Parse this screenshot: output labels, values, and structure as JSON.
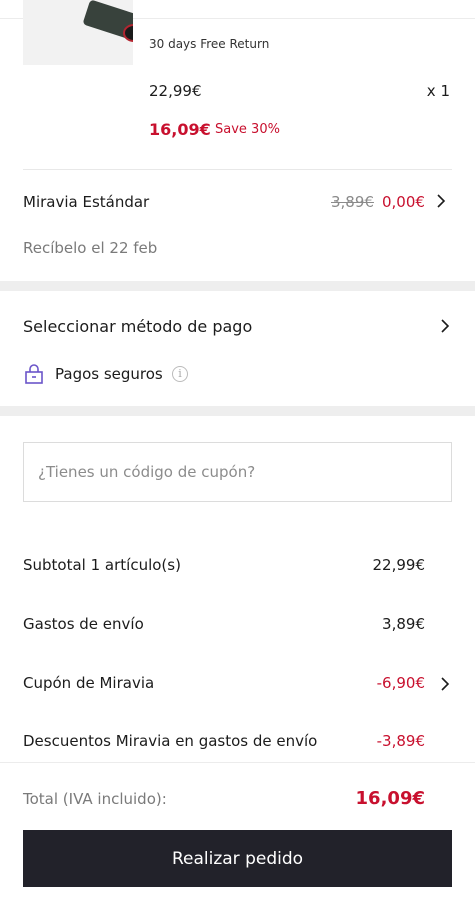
{
  "product": {
    "return_policy": "30 days Free Return",
    "price": "22,99€",
    "quantity": "x 1",
    "sale_price": "16,09€",
    "save_text": "Save 30%"
  },
  "shipping": {
    "method": "Miravia Estándar",
    "old_price": "3,89€",
    "new_price": "0,00€",
    "delivery_date": "Recíbelo el 22 feb"
  },
  "payment": {
    "select_label": "Seleccionar método de pago",
    "secure_label": "Pagos seguros",
    "info_glyph": "i"
  },
  "coupon": {
    "placeholder": "¿Tienes un código de cupón?",
    "value": ""
  },
  "summary": {
    "rows": [
      {
        "label": "Subtotal 1 artículo(s)",
        "value": "22,99€"
      },
      {
        "label": "Gastos de envío",
        "value": "3,89€"
      },
      {
        "label": "Cupón de Miravia",
        "value": "-6,90€"
      },
      {
        "label": "Descuentos Miravia en gastos de envío",
        "value": "-3,89€"
      }
    ],
    "total_label": "Total (IVA incluido):",
    "total_value": "16,09€"
  },
  "cta_label": "Realizar pedido",
  "colors": {
    "accent_red": "#c8102e",
    "button_bg": "#22222a",
    "lock_purple": "#6b55c9"
  }
}
